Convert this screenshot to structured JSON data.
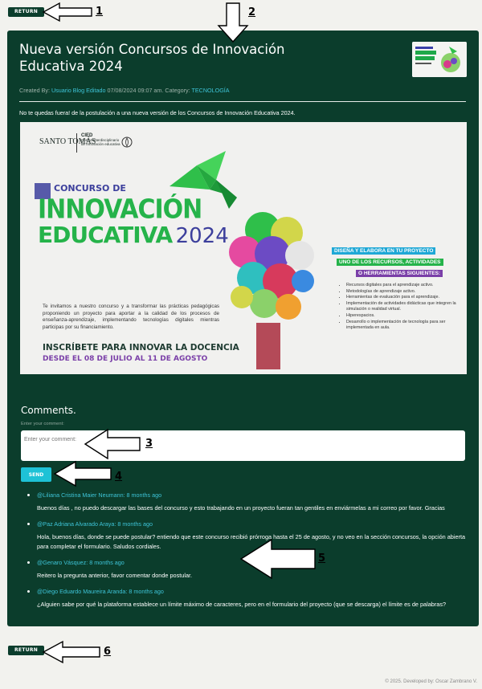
{
  "nav": {
    "return_top": "RETURN",
    "return_bottom": "RETURN"
  },
  "post": {
    "title": "Nueva versión Concursos de Innovación Educativa 2024",
    "created_by_prefix": "Created By: ",
    "author": "Usuario Blog Editado",
    "date": " 07/08/2024 09:07 am. Category: ",
    "category": "TECNOLOGÍA",
    "intro": "No te quedas fuera! de la postulación a una nueva versión de los Concursos de Innovación Educativa 2024."
  },
  "poster": {
    "brand": "SANTO TOMÁS",
    "cied_short": "CIED",
    "cied_line1": "Centro Interdisciplinario",
    "cied_line2": "de Innovación educativa",
    "headline1": "CONCURSO DE",
    "headline2": "INNOVACIÓN",
    "headline3": "EDUCATIVA",
    "year": "2024",
    "body": "Te invitamos a nuestro concurso y a transformar las prácticas pedagógicas proponiendo un proyecto para aportar a la calidad de los procesos de enseñanza-aprendizaje, implementando tecnologías digitales mientras participas por su financiamiento.",
    "cta": "INSCRÍBETE PARA INNOVAR LA DOCENCIA",
    "dates": "DESDE EL 08 DE JULIO AL 11 DE AGOSTO",
    "tag1": "DISEÑA Y ELABORA EN TU PROYECTO",
    "tag2": "UNO DE LOS RECURSOS, ACTIVIDADES",
    "tag3": "O HERRAMIENTAS SIGUIENTES:",
    "bullets": [
      "Recursos digitales para el aprendizaje activo.",
      "Metodologías de aprendizaje activo.",
      "Herramientas de evaluación para el aprendizaje.",
      "Implementación de actividades didácticas que integren la simulación o realidad virtual.",
      "Hiperespacios.",
      "Desarrollo o implementación de tecnología para ser implementada en aula."
    ]
  },
  "comments_section": {
    "heading": "Comments.",
    "label": "Enter your comment:",
    "placeholder": "Enter your comment:",
    "send": "SEND"
  },
  "comments": [
    {
      "author": "@Liliana Cristina Maier Neumann: 8 months ago",
      "text": "Buenos días , no puedo descargar las bases del concurso y esto trabajando en un proyecto fueran tan gentiles en enviármelas a mi correo por favor. Gracias"
    },
    {
      "author": "@Paz Adriana Alvarado Araya: 8 months ago",
      "text": "Hola, buenos días, donde se puede postular? entiendo que este concurso recibió prórroga hasta el 25 de agosto, y no veo en la sección concursos, la opción abierta para completar el formulario. Saludos cordiales."
    },
    {
      "author": "@Genaro Vásquez: 8 months ago",
      "text": "Reitero la pregunta anterior, favor comentar donde postular."
    },
    {
      "author": "@Diego Eduardo Maureira Aranda: 8 months ago",
      "text": "¿Alguien sabe por qué la plataforma establece un límite máximo de caracteres, pero en el formulario del proyecto (que se descarga) el límite es de palabras?"
    }
  ],
  "footer": {
    "text": "© 2025. Developed by: Oscar Zambrano V."
  },
  "annotations": {
    "n1": "1",
    "n2": "2",
    "n3": "3",
    "n4": "4",
    "n5": "5",
    "n6": "6"
  }
}
